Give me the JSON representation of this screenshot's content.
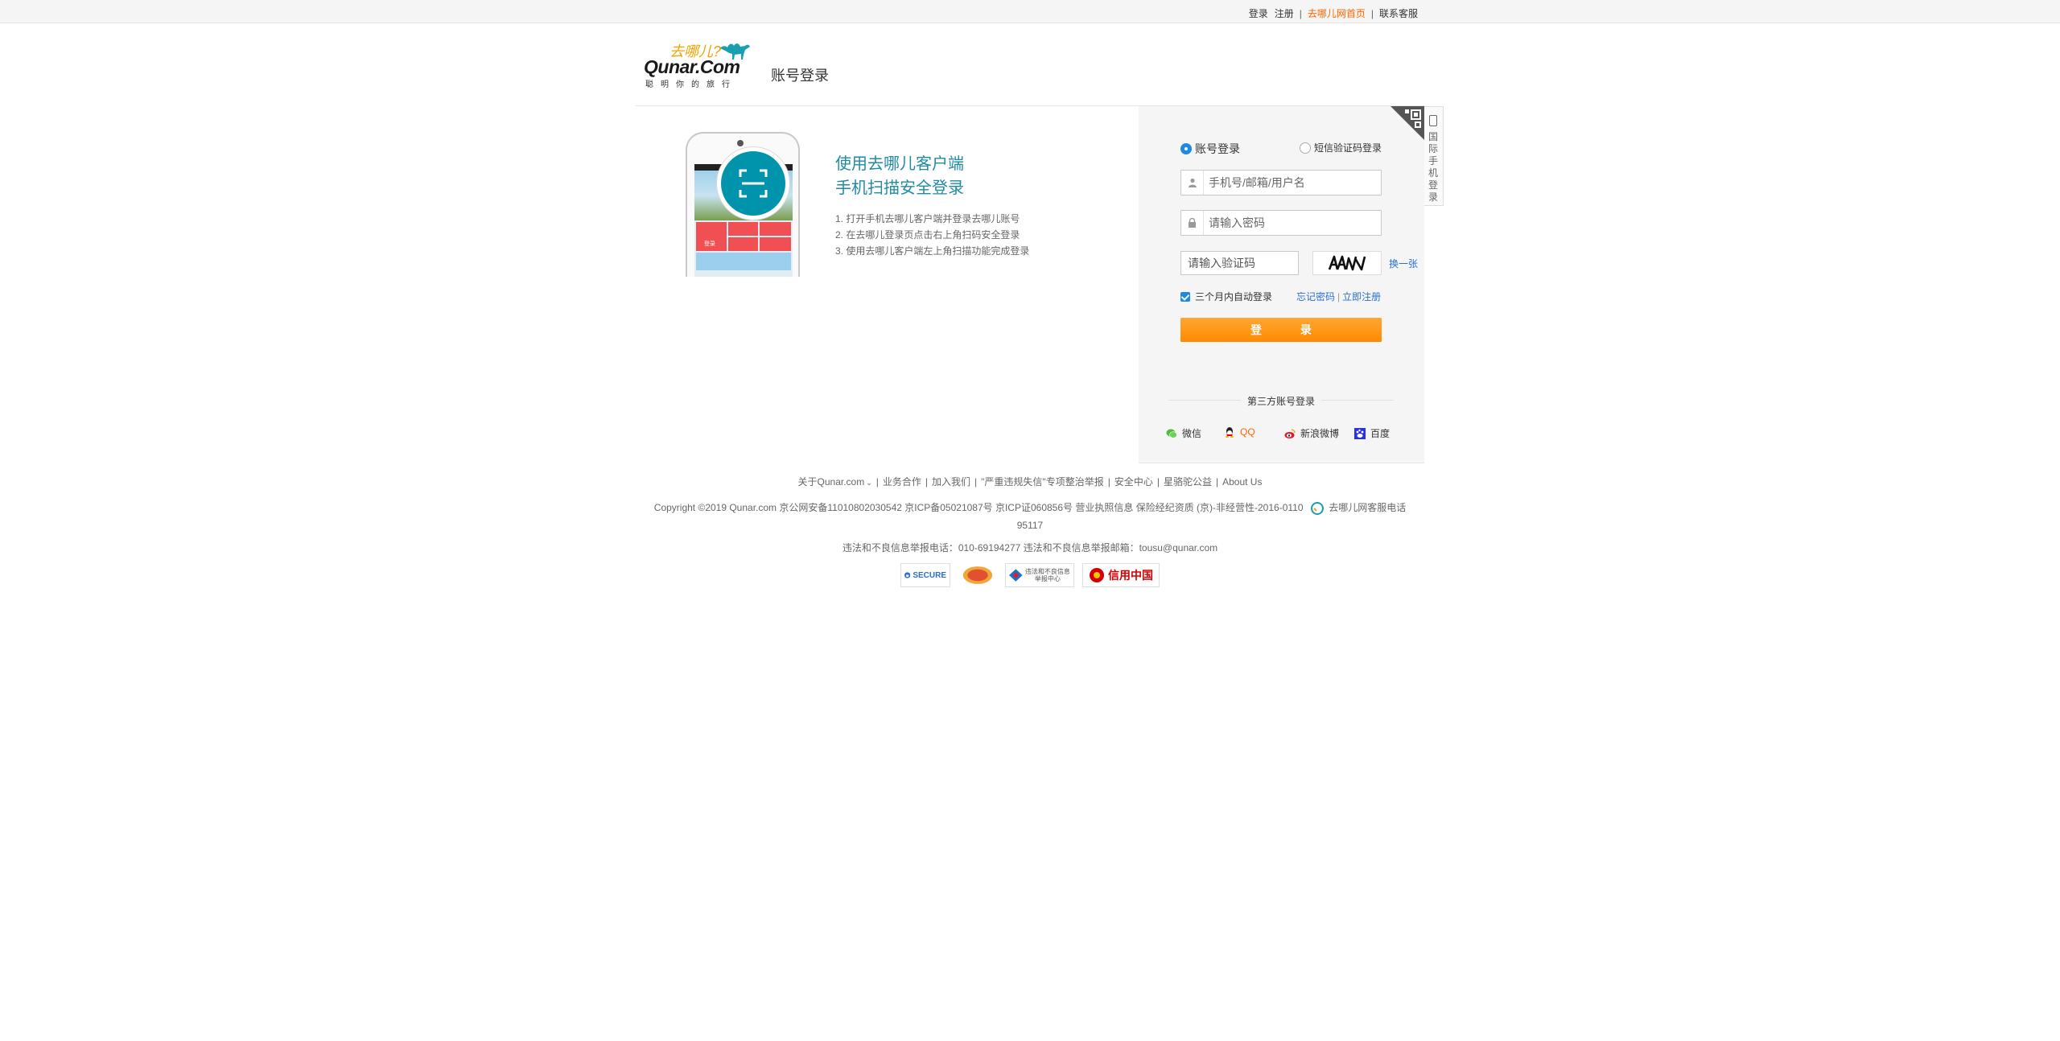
{
  "topbar": {
    "login": "登录",
    "register": "注册",
    "home": "去哪儿网首页",
    "contact": "联系客服",
    "sep": "|"
  },
  "header": {
    "logo_cn": "去哪儿?",
    "logo_en": "Qunar.Com",
    "logo_slogan": "聪明你的旅行",
    "title": "账号登录"
  },
  "promo": {
    "title_line1": "使用去哪儿客户端",
    "title_line2": "手机扫描安全登录",
    "steps": [
      "1. 打开手机去哪儿客户端并登录去哪儿账号",
      "2. 在去哪儿登录页点击右上角扫码安全登录",
      "3. 使用去哪儿客户端左上角扫描功能完成登录"
    ],
    "phone_tile_label": "登录"
  },
  "side_tab": {
    "text": "国际手机登录"
  },
  "login": {
    "tab_account": "账号登录",
    "tab_sms": "短信验证码登录",
    "username_placeholder": "手机号/邮箱/用户名",
    "password_placeholder": "请输入密码",
    "code_placeholder": "请输入验证码",
    "captcha_text": "AAΛN",
    "refresh": "换一张",
    "remember": "三个月内自动登录",
    "forgot": "忘记密码",
    "register": "立即注册",
    "submit": "登 录",
    "third_title": "第三方账号登录",
    "third": [
      {
        "name": "微信",
        "icon": "wechat-icon"
      },
      {
        "name": "QQ",
        "icon": "qq-icon"
      },
      {
        "name": "新浪微博",
        "icon": "weibo-icon"
      },
      {
        "name": "百度",
        "icon": "baidu-icon"
      }
    ]
  },
  "footer": {
    "links": [
      "关于Qunar.com",
      "业务合作",
      "加入我们",
      "\"严重违规失信\"专项整治举报",
      "安全中心",
      "星骆驼公益",
      "About Us"
    ],
    "copyright": "Copyright ©2019 Qunar.com   京公网安备11010802030542   京ICP备05021087号   京ICP证060856号   营业执照信息   保险经纪资质   (京)-非经营性-2016-0110",
    "hotline": "去哪儿网客服电话 95117",
    "report": "违法和不良信息举报电话：010-69194277   违法和不良信息举报邮箱：tousu@qunar.com",
    "badges": [
      "SECURE",
      "",
      "违法和不良信息举报中心",
      "信用中国"
    ]
  },
  "colors": {
    "accent_orange": "#ff8a00",
    "link_blue": "#2a6ed5",
    "promo_teal": "#1f8ba5",
    "home_link": "#ff6600"
  }
}
